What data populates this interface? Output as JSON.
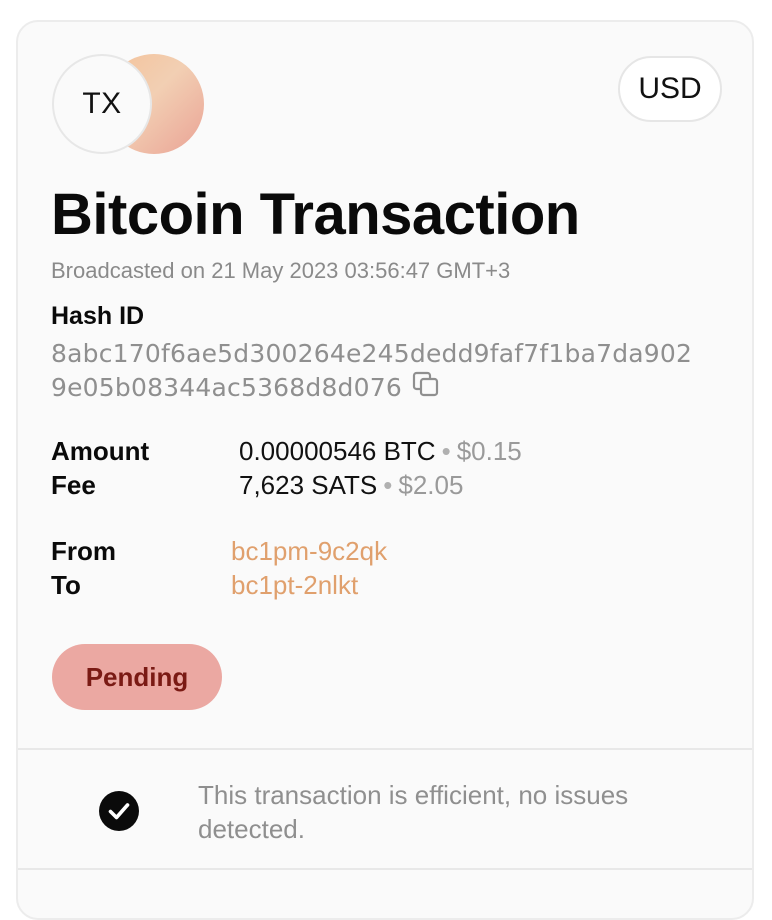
{
  "header": {
    "avatar_text": "TX",
    "currency_label": "USD"
  },
  "title": "Bitcoin Transaction",
  "broadcast_text": "Broadcasted on 21 May 2023 03:56:47 GMT+3",
  "hash": {
    "label": "Hash ID",
    "line1": "8abc170f6ae5d300264e245dedd9faf7f1ba7da902",
    "line2": "9e05b08344ac5368d8d076"
  },
  "amount": {
    "label": "Amount",
    "value": "0.00000546 BTC",
    "separator": "•",
    "usd": "$0.15"
  },
  "fee": {
    "label": "Fee",
    "value": "7,623 SATS",
    "separator": "•",
    "usd": "$2.05"
  },
  "from": {
    "label": "From",
    "address": "bc1pm-9c2qk"
  },
  "to": {
    "label": "To",
    "address": "bc1pt-2nlkt"
  },
  "status": {
    "label": "Pending",
    "color": "#eba8a2",
    "text_color": "#7a1a14"
  },
  "efficiency": {
    "icon": "check-circle-icon",
    "text": "This transaction is efficient, no issues detected."
  },
  "colors": {
    "accent": "#e0a06d",
    "muted_text": "#8f8f8f"
  }
}
